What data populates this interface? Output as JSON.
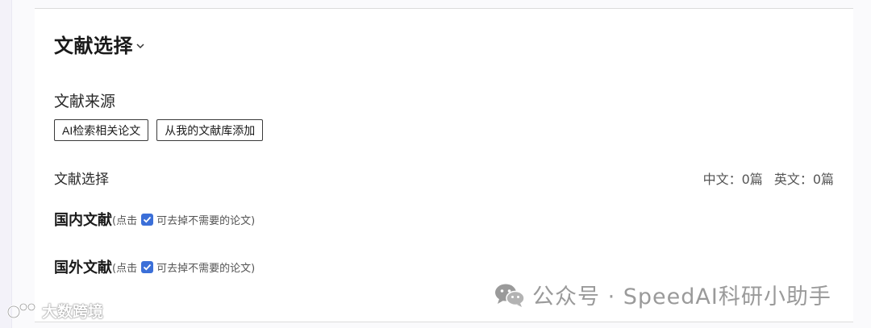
{
  "section": {
    "title": "文献选择"
  },
  "source": {
    "label": "文献来源",
    "buttons": [
      "AI检索相关论文",
      "从我的文献库添加"
    ]
  },
  "selection": {
    "label": "文献选择",
    "chinese_count": "中文：0篇",
    "english_count": "英文：0篇"
  },
  "domestic": {
    "title": "国内文献",
    "hint_prefix": "(点击",
    "hint_suffix": "可去掉不需要的论文)"
  },
  "foreign": {
    "title": "国外文献",
    "hint_prefix": "(点击",
    "hint_suffix": "可去掉不需要的论文)"
  },
  "watermarks": {
    "wechat": "公众号 · SpeedAI科研小助手",
    "corner": "大数跨境"
  },
  "colors": {
    "checkbox": "#3b6fd8",
    "border": "#3a3a3a"
  }
}
